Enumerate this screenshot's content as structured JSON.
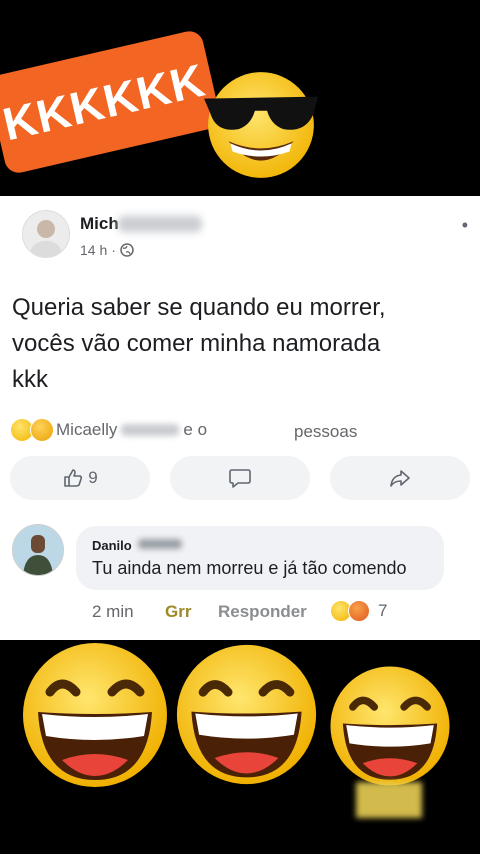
{
  "sticker": {
    "banner_text": "KKKKKK",
    "cool_emoji_icon": "sunglasses-face-icon"
  },
  "post": {
    "author_visible": "Mich",
    "time": "14 h",
    "separator": "·",
    "privacy_icon": "globe-icon",
    "text": "Queria saber se quando eu morrer,\nvocês vão comer minha namorada\nkkk",
    "reactions": {
      "icons": [
        "laugh-reaction-icon",
        "care-reaction-icon"
      ],
      "name": "Micaelly",
      "connector": "e o",
      "suffix": "pessoas"
    },
    "actions": [
      {
        "name": "like",
        "icon": "thumbs-up-icon",
        "count": "9"
      },
      {
        "name": "comment",
        "icon": "comment-icon",
        "count": ""
      },
      {
        "name": "share",
        "icon": "share-icon",
        "count": ""
      }
    ]
  },
  "comment": {
    "author_visible": "Danilo",
    "text": "Tu ainda nem morreu e já tão comendo",
    "time": "2 min",
    "grr": "Grr",
    "reply": "Responder",
    "reaction_count": "7",
    "reaction_icons": [
      "laugh-reaction-icon",
      "angry-reaction-icon"
    ]
  },
  "colors": {
    "banner": "#f26522",
    "emoji_yellow": "#f7c51e",
    "card_bg": "#ffffff"
  }
}
